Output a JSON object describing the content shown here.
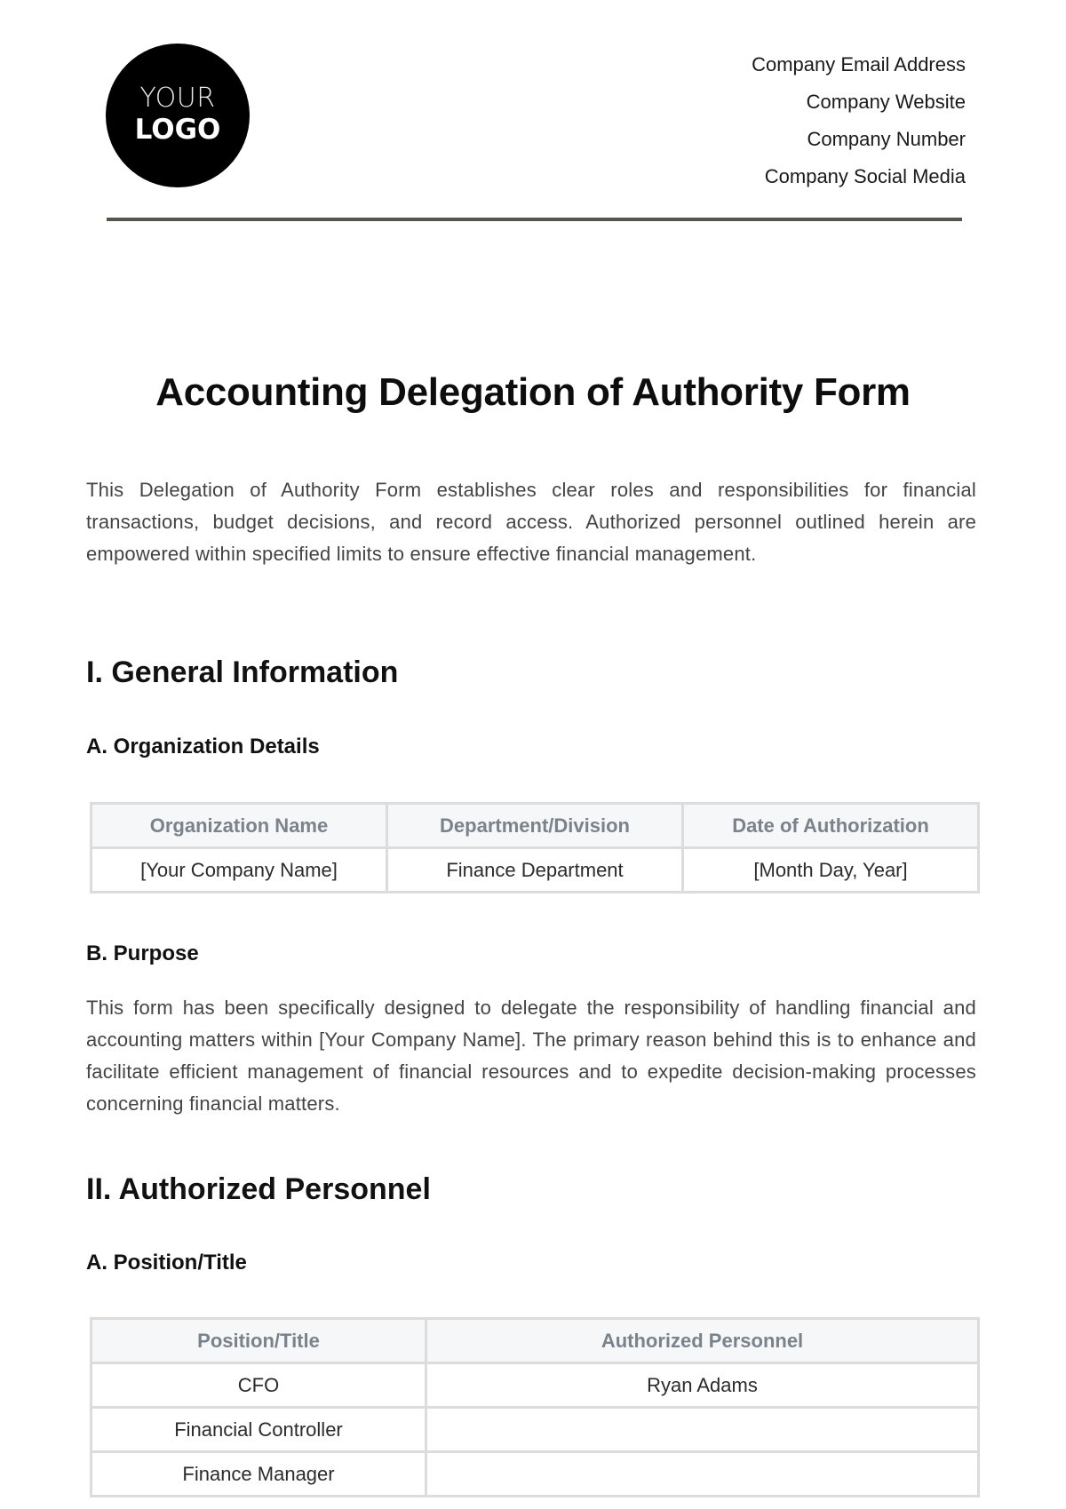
{
  "header": {
    "logo": {
      "line1": "YOUR",
      "line2": "LOGO"
    },
    "contact": [
      "Company Email Address",
      "Company Website",
      "Company Number",
      "Company Social Media"
    ]
  },
  "document": {
    "title": "Accounting Delegation of Authority Form",
    "intro": "This Delegation of Authority Form establishes clear roles and responsibilities for financial transactions, budget decisions, and record access. Authorized personnel outlined herein are empowered within specified limits to ensure effective financial management.",
    "section1": {
      "heading": "I. General Information",
      "subA": {
        "heading": "A. Organization Details",
        "table": {
          "headers": [
            "Organization Name",
            "Department/Division",
            "Date of Authorization"
          ],
          "rows": [
            [
              "[Your Company Name]",
              "Finance Department",
              "[Month Day, Year]"
            ]
          ]
        }
      },
      "subB": {
        "heading": "B. Purpose",
        "text": "This form has been specifically designed to delegate the responsibility of handling financial and accounting matters within [Your Company Name]. The primary reason behind this is to enhance and facilitate efficient management of financial resources and to expedite decision-making processes concerning financial matters."
      }
    },
    "section2": {
      "heading": "II. Authorized Personnel",
      "subA": {
        "heading": "A. Position/Title",
        "table": {
          "headers": [
            "Position/Title",
            "Authorized Personnel"
          ],
          "rows": [
            [
              "CFO",
              "Ryan Adams"
            ],
            [
              "Financial Controller",
              ""
            ],
            [
              "Finance Manager",
              ""
            ]
          ]
        }
      }
    }
  }
}
